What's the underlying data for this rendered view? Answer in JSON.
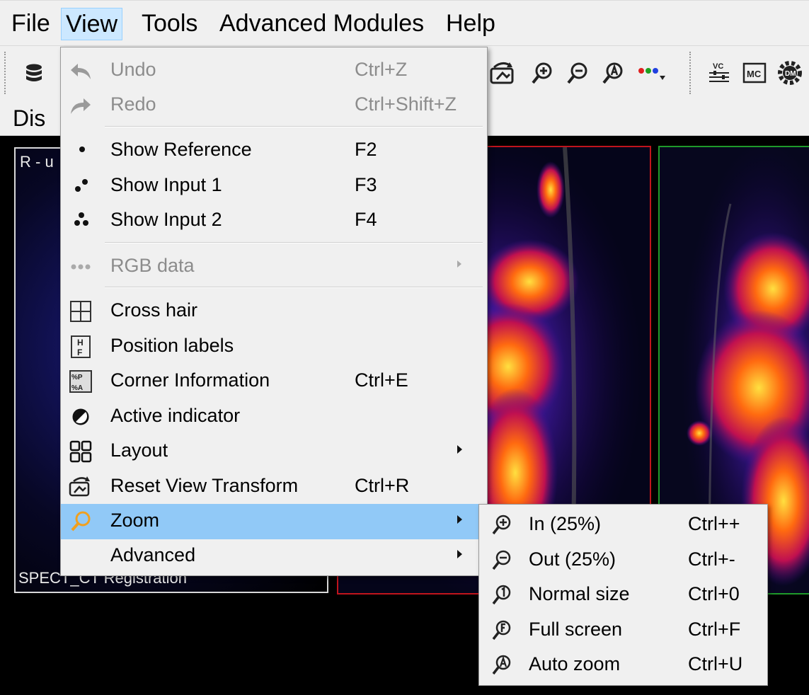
{
  "menubar": {
    "items": [
      "File",
      "View",
      "Tools",
      "Advanced Modules",
      "Help"
    ],
    "active": "View"
  },
  "toolbar": {
    "icons": [
      "database-icon",
      "reset-view-icon",
      "zoom-in-icon",
      "zoom-out-icon",
      "auto-zoom-icon",
      "rgb-dots-icon",
      "vc-icon",
      "mc-icon",
      "dm-gear-icon"
    ]
  },
  "tab": {
    "label": "Dis"
  },
  "viewport": {
    "left_pane_top_label": "R - u",
    "left_pane_bottom_label": "SPECT_CT Registration",
    "pane_border_colors": {
      "left": "#d8d8d8",
      "middle": "#c0141c",
      "right": "#1f9a2a"
    }
  },
  "view_menu": {
    "undo": {
      "label": "Undo",
      "shortcut": "Ctrl+Z",
      "icon": "undo-icon"
    },
    "redo": {
      "label": "Redo",
      "shortcut": "Ctrl+Shift+Z",
      "icon": "redo-icon"
    },
    "show_reference": {
      "label": "Show Reference",
      "shortcut": "F2",
      "icon": "one-dot-icon"
    },
    "show_input1": {
      "label": "Show Input 1",
      "shortcut": "F3",
      "icon": "two-dots-icon"
    },
    "show_input2": {
      "label": "Show Input 2",
      "shortcut": "F4",
      "icon": "three-dots-icon"
    },
    "rgb_data": {
      "label": "RGB data",
      "icon": "rgb-data-icon"
    },
    "cross_hair": {
      "label": "Cross hair",
      "icon": "cross-hair-icon"
    },
    "position_labels": {
      "label": "Position labels",
      "icon": "position-labels-icon"
    },
    "corner_information": {
      "label": "Corner Information",
      "shortcut": "Ctrl+E",
      "icon": "corner-information-icon"
    },
    "active_indicator": {
      "label": "Active indicator",
      "icon": "active-indicator-icon"
    },
    "layout": {
      "label": "Layout",
      "icon": "layout-icon"
    },
    "reset_view_transform": {
      "label": "Reset View Transform",
      "shortcut": "Ctrl+R",
      "icon": "reset-view-icon"
    },
    "zoom": {
      "label": "Zoom",
      "icon": "magnifier-icon"
    },
    "advanced": {
      "label": "Advanced"
    }
  },
  "zoom_submenu": {
    "zoom_in": {
      "label": "In (25%)",
      "shortcut": "Ctrl++",
      "icon": "zoom-in-icon"
    },
    "zoom_out": {
      "label": "Out (25%)",
      "shortcut": "Ctrl+-",
      "icon": "zoom-out-icon"
    },
    "normal_size": {
      "label": "Normal size",
      "shortcut": "Ctrl+0",
      "icon": "zoom-normal-icon"
    },
    "full_screen": {
      "label": "Full screen",
      "shortcut": "Ctrl+F",
      "icon": "zoom-fullscreen-icon"
    },
    "auto_zoom": {
      "label": "Auto zoom",
      "shortcut": "Ctrl+U",
      "icon": "zoom-auto-icon"
    }
  },
  "colors": {
    "highlight": "#91c9f7",
    "menu_bg": "#f0f0f0",
    "zoom_icon": "#f0a020"
  }
}
